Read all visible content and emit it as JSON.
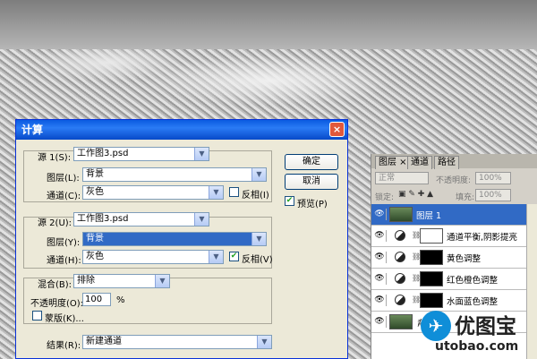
{
  "dialog": {
    "title": "计算",
    "close": "×",
    "source1": {
      "label": "源 1(S):",
      "file": "工作图3.psd",
      "layer_label": "图层(L):",
      "layer": "背景",
      "channel_label": "通道(C):",
      "channel": "灰色",
      "invert_label": "反相(I)",
      "invert": false
    },
    "source2": {
      "label": "源 2(U):",
      "file": "工作图3.psd",
      "layer_label": "图层(Y):",
      "layer": "背景",
      "channel_label": "通道(H):",
      "channel": "灰色",
      "invert_label": "反相(V)",
      "invert": true
    },
    "blend": {
      "label": "混合(B):",
      "mode": "排除",
      "opacity_label": "不透明度(O):",
      "opacity": "100",
      "percent": "%",
      "mask_label": "蒙版(K)..."
    },
    "result": {
      "label": "结果(R):",
      "value": "新建通道"
    },
    "ok": "确定",
    "cancel": "取消",
    "preview_label": "预览(P)",
    "preview": true
  },
  "layers_panel": {
    "tabs": [
      "图层 ×",
      "通道",
      "路径"
    ],
    "blend_mode": "正常",
    "opacity_label": "不透明度:",
    "opacity": "100%",
    "lock_label": "锁定:",
    "fill_label": "填充:",
    "fill": "100%",
    "layers": [
      {
        "name": "图层 1",
        "selected": true,
        "type": "pixel"
      },
      {
        "name": "通道平衡,阴影提亮",
        "selected": false,
        "type": "adjustment"
      },
      {
        "name": "黄色调整",
        "selected": false,
        "type": "adjustment"
      },
      {
        "name": "红色橙色调整",
        "selected": false,
        "type": "adjustment"
      },
      {
        "name": "水面蓝色调整",
        "selected": false,
        "type": "adjustment"
      },
      {
        "name": "背景",
        "selected": false,
        "type": "pixel"
      }
    ]
  },
  "watermark": {
    "cn": "优图宝",
    "en": "utobao.com"
  },
  "colors": {
    "title_bar": "#0a5ae0",
    "selection": "#316ac5",
    "dialog_bg": "#ece9d8"
  }
}
